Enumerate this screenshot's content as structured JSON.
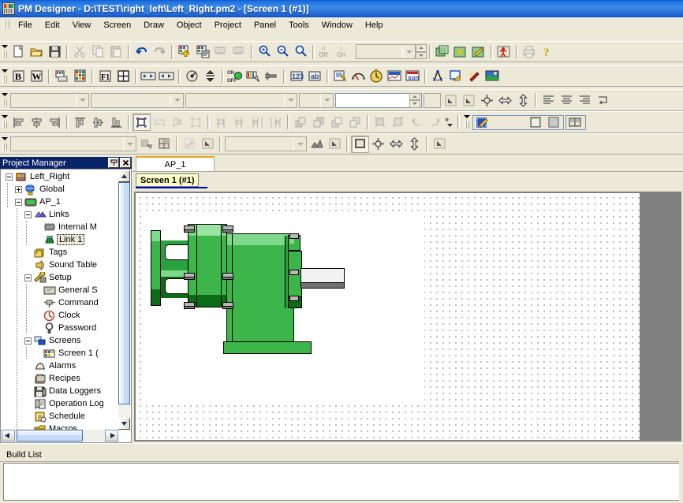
{
  "window": {
    "icon": "pm-designer-icon",
    "title": "PM Designer - D:\\TEST\\right_left\\Left_Right.pm2 - [Screen 1 (#1)]"
  },
  "menubar": {
    "items": [
      {
        "label": "File",
        "accel": "F"
      },
      {
        "label": "Edit",
        "accel": "E"
      },
      {
        "label": "View",
        "accel": "V"
      },
      {
        "label": "Screen",
        "accel": "S"
      },
      {
        "label": "Draw",
        "accel": "D"
      },
      {
        "label": "Object",
        "accel": "O"
      },
      {
        "label": "Project",
        "accel": "P"
      },
      {
        "label": "Panel",
        "accel": "a"
      },
      {
        "label": "Tools",
        "accel": "T"
      },
      {
        "label": "Window",
        "accel": "W"
      },
      {
        "label": "Help",
        "accel": "H"
      }
    ]
  },
  "toolbar_standard": {
    "buttons": [
      {
        "name": "new-icon",
        "tip": "New"
      },
      {
        "name": "open-folder-icon",
        "tip": "Open"
      },
      {
        "name": "save-disk-icon",
        "tip": "Save"
      },
      {
        "name": "cut-scissors-icon",
        "tip": "Cut",
        "disabled": true
      },
      {
        "name": "copy-icon",
        "tip": "Copy",
        "disabled": true
      },
      {
        "name": "paste-icon",
        "tip": "Paste",
        "disabled": true
      },
      {
        "name": "undo-arrow-icon",
        "tip": "Undo"
      },
      {
        "name": "redo-arrow-icon",
        "tip": "Redo",
        "disabled": true
      },
      {
        "name": "add-screen-icon",
        "tip": "New Screen"
      },
      {
        "name": "screen-properties-icon",
        "tip": "Screen Properties"
      },
      {
        "name": "previous-screen-icon",
        "tip": "Previous Screen",
        "disabled": true
      },
      {
        "name": "next-screen-icon",
        "tip": "Next Screen",
        "disabled": true
      },
      {
        "name": "zoom-in-icon",
        "tip": "Zoom In"
      },
      {
        "name": "zoom-out-icon",
        "tip": "Zoom Out"
      },
      {
        "name": "zoom-icon",
        "tip": "Zoom"
      },
      {
        "name": "state-off-icon",
        "tip": "Off State",
        "label": "0 Off",
        "disabled": true
      },
      {
        "name": "state-on-icon",
        "tip": "On State",
        "label": "1 On",
        "disabled": true
      }
    ],
    "state_combo": {
      "value": "",
      "placeholder": ""
    },
    "right_buttons": [
      {
        "name": "compile-icon",
        "tip": "Compile"
      },
      {
        "name": "download-icon",
        "tip": "Download"
      },
      {
        "name": "online-edit-icon",
        "tip": "Online Simulation"
      },
      {
        "name": "stop-runtime-icon",
        "tip": "Stop"
      },
      {
        "name": "print-icon",
        "tip": "Print",
        "disabled": true
      },
      {
        "name": "help-question-icon",
        "tip": "Help"
      }
    ]
  },
  "toolbar_objects": {
    "buttons": [
      {
        "name": "bit-button-icon",
        "tip": "Bit Button"
      },
      {
        "name": "word-button-icon",
        "tip": "Word Button"
      },
      {
        "name": "screen-button-icon",
        "tip": "Screen Button"
      },
      {
        "name": "keypad-button-icon",
        "tip": "Keypad Button"
      },
      {
        "name": "function-key-icon",
        "tip": "Function Key"
      },
      {
        "name": "multi-state-icon",
        "tip": "Multi-State"
      },
      {
        "name": "step-button-icon",
        "tip": "Step Button"
      },
      {
        "name": "slider-arrows-icon",
        "tip": "Slide Switch"
      },
      {
        "name": "radio-dial-icon",
        "tip": "Selector Switch"
      },
      {
        "name": "updown-arrows-icon",
        "tip": "Up/Down Button"
      },
      {
        "name": "on-off-lamp-icon",
        "tip": "On/Off Lamp"
      },
      {
        "name": "multi-state-lamp-icon",
        "tip": "Multi-State Lamp"
      },
      {
        "name": "pipe-valve-icon",
        "tip": "Pipeline"
      },
      {
        "name": "numeric-entry-icon",
        "tip": "Numeric Entry"
      },
      {
        "name": "character-entry-icon",
        "tip": "Character Entry"
      },
      {
        "name": "text-input-icon",
        "tip": "Text Input"
      },
      {
        "name": "numeric-display-icon",
        "tip": "Numeric Display"
      },
      {
        "name": "ascii-display-icon",
        "tip": "ASCII Display"
      },
      {
        "name": "message-display-icon",
        "tip": "Message Display"
      },
      {
        "name": "meter-gauge-icon",
        "tip": "Meter"
      },
      {
        "name": "clock-display-icon",
        "tip": "Clock Display"
      },
      {
        "name": "trend-graph-icon",
        "tip": "Trend Graph"
      },
      {
        "name": "calendar-icon",
        "tip": "Calendar"
      },
      {
        "name": "draw-compass-icon",
        "tip": "Drawing Tools"
      },
      {
        "name": "shape-select-icon",
        "tip": "Shape"
      },
      {
        "name": "magic-wand-icon",
        "tip": "Effects"
      },
      {
        "name": "picture-icon",
        "tip": "Bitmap"
      }
    ]
  },
  "toolbar_format": {
    "font_combo": {
      "value": "",
      "placeholder": ""
    },
    "size_combo": {
      "value": "",
      "placeholder": ""
    },
    "style_combo": {
      "value": "",
      "placeholder": ""
    },
    "extra_combo": {
      "value": "",
      "placeholder": ""
    },
    "coord_field": {
      "value": ""
    },
    "width_spin": {
      "value": ""
    },
    "align_buttons": [
      {
        "name": "fill-color-icon",
        "tip": "Fill Color"
      },
      {
        "name": "line-color-icon",
        "tip": "Line Color"
      },
      {
        "name": "center-target-icon",
        "tip": "Center"
      },
      {
        "name": "flip-horizontal-icon",
        "tip": "Flip Horizontal"
      },
      {
        "name": "flip-vertical-icon",
        "tip": "Flip Vertical"
      },
      {
        "name": "align-left-text-icon",
        "tip": "Align Left"
      },
      {
        "name": "align-center-text-icon",
        "tip": "Align Center"
      },
      {
        "name": "align-right-text-icon",
        "tip": "Align Right"
      },
      {
        "name": "wrap-text-icon",
        "tip": "Wrap Text"
      }
    ]
  },
  "toolbar_align": {
    "buttons": [
      {
        "name": "align-left-icon",
        "tip": "Align Left"
      },
      {
        "name": "align-hcenter-icon",
        "tip": "Align Center"
      },
      {
        "name": "align-right-icon",
        "tip": "Align Right"
      },
      {
        "name": "align-top-icon",
        "tip": "Align Top"
      },
      {
        "name": "align-vcenter-icon",
        "tip": "Align Middle"
      },
      {
        "name": "align-bottom-icon",
        "tip": "Align Bottom"
      },
      {
        "name": "group-selected-icon",
        "tip": "Group",
        "pressed": true
      },
      {
        "name": "ungroup-icon",
        "tip": "Ungroup",
        "disabled": true
      },
      {
        "name": "make-same-size-icon",
        "tip": "Make Same Size",
        "disabled": true
      },
      {
        "name": "size-to-fit-icon",
        "tip": "Size to Fit",
        "disabled": true
      },
      {
        "name": "space-horizontal-icon",
        "tip": "Space Horizontally",
        "disabled": true
      },
      {
        "name": "space-vertical-icon",
        "tip": "Space Vertically",
        "disabled": true
      },
      {
        "name": "distribute-h-icon",
        "tip": "Distribute Horizontally",
        "disabled": true
      },
      {
        "name": "distribute-v-icon",
        "tip": "Distribute Vertically",
        "disabled": true
      },
      {
        "name": "bring-front-icon",
        "tip": "Bring to Front",
        "disabled": true
      },
      {
        "name": "send-back-icon",
        "tip": "Send to Back",
        "disabled": true
      },
      {
        "name": "bring-forward-icon",
        "tip": "Bring Forward",
        "disabled": true
      },
      {
        "name": "send-backward-icon",
        "tip": "Send Backward",
        "disabled": true
      },
      {
        "name": "group-objects-icon",
        "tip": "Group Objects",
        "disabled": true
      },
      {
        "name": "ungroup-objects-icon",
        "tip": "Ungroup Objects",
        "disabled": true
      },
      {
        "name": "rotate-left-icon",
        "tip": "Rotate Left",
        "disabled": true
      },
      {
        "name": "rotate-right-icon",
        "tip": "Rotate Right",
        "disabled": true
      }
    ],
    "overflow_label": "»",
    "right_panel": [
      {
        "name": "tag-editor-icon",
        "tip": "Tag Editor"
      },
      {
        "name": "panel-layout-icon",
        "tip": "Panel Layout"
      },
      {
        "name": "grid-pattern-icon",
        "tip": "Grid"
      },
      {
        "name": "library-book-icon",
        "tip": "Library"
      }
    ]
  },
  "toolbar_draw": {
    "shape_combo": {
      "value": "",
      "placeholder": ""
    },
    "buttons": [
      {
        "name": "fill-bucket-icon",
        "tip": "Fill Pattern"
      },
      {
        "name": "grid-snap-icon",
        "tip": "Snap to Grid"
      },
      {
        "name": "line-style-icon",
        "tip": "Line Style",
        "disabled": true
      },
      {
        "name": "line-width-icon",
        "tip": "Line Width"
      },
      {
        "name": "gradient-icon",
        "tip": "Gradient"
      },
      {
        "name": "border-style-icon",
        "tip": "Border"
      },
      {
        "name": "center-point-icon",
        "tip": "Center Point"
      },
      {
        "name": "width-arrows-icon",
        "tip": "Width"
      },
      {
        "name": "height-arrows-icon",
        "tip": "Height"
      },
      {
        "name": "pattern-picker-icon",
        "tip": "Pattern"
      }
    ],
    "pattern_combo": {
      "value": "",
      "placeholder": ""
    }
  },
  "project_manager": {
    "title": "Project Manager",
    "pin_icon": "pin-icon",
    "close_icon": "close-icon",
    "tree": [
      {
        "label": "Left_Right",
        "depth": 0,
        "expander": "minus",
        "icon": "project-icon"
      },
      {
        "label": "Global",
        "depth": 1,
        "expander": "plus",
        "icon": "globe-icon"
      },
      {
        "label": "AP_1",
        "depth": 1,
        "expander": "minus",
        "icon": "panel-icon"
      },
      {
        "label": "Links",
        "depth": 2,
        "expander": "minus",
        "icon": "links-icon"
      },
      {
        "label": "Internal M",
        "depth": 3,
        "expander": "none",
        "icon": "chip-icon"
      },
      {
        "label": "Link 1",
        "depth": 3,
        "expander": "none",
        "icon": "link-icon",
        "selected": true
      },
      {
        "label": "Tags",
        "depth": 2,
        "expander": "none",
        "icon": "tags-icon"
      },
      {
        "label": "Sound Table",
        "depth": 2,
        "expander": "none",
        "icon": "sound-icon"
      },
      {
        "label": "Setup",
        "depth": 2,
        "expander": "minus",
        "icon": "wrench-icon"
      },
      {
        "label": "General S",
        "depth": 3,
        "expander": "none",
        "icon": "general-setup-icon"
      },
      {
        "label": "Command",
        "depth": 3,
        "expander": "none",
        "icon": "command-icon"
      },
      {
        "label": "Clock",
        "depth": 3,
        "expander": "none",
        "icon": "clock-icon"
      },
      {
        "label": "Password",
        "depth": 3,
        "expander": "none",
        "icon": "password-icon"
      },
      {
        "label": "Screens",
        "depth": 2,
        "expander": "minus",
        "icon": "screens-icon"
      },
      {
        "label": "Screen 1 (",
        "depth": 3,
        "expander": "none",
        "icon": "screen-icon"
      },
      {
        "label": "Alarms",
        "depth": 2,
        "expander": "none",
        "icon": "alarm-bell-icon"
      },
      {
        "label": "Recipes",
        "depth": 2,
        "expander": "none",
        "icon": "recipes-icon"
      },
      {
        "label": "Data Loggers",
        "depth": 2,
        "expander": "none",
        "icon": "data-logger-icon"
      },
      {
        "label": "Operation Log",
        "depth": 2,
        "expander": "none",
        "icon": "operation-log-icon"
      },
      {
        "label": "Schedule",
        "depth": 2,
        "expander": "none",
        "icon": "schedule-icon"
      },
      {
        "label": "Macros",
        "depth": 2,
        "expander": "none",
        "icon": "macros-icon"
      }
    ]
  },
  "editor": {
    "panel_tab": "AP_1",
    "screen_tab": "Screen 1 (#1)",
    "canvas": {
      "grid": true,
      "object_name": "motor-gearbox-graphic"
    }
  },
  "build": {
    "title": "Build List",
    "entries": []
  },
  "colors": {
    "title_blue": "#1f6fe0",
    "dock_title_blue": "#0a246a",
    "toolbar_bg": "#ece9d8",
    "tab_accent_orange": "#e8a020",
    "screen_tab_yellow": "#ffffc8",
    "screen_tab_underline": "#0000cc",
    "canvas_gray": "#808080",
    "motor_green_mid": "#2aa13f",
    "motor_green_light": "#7fd98a",
    "motor_green_dark": "#0b6b17",
    "motor_shaft_white": "#f2f2f2",
    "motor_shaft_gray": "#707070",
    "bolt_gray": "#b8b8b8"
  }
}
